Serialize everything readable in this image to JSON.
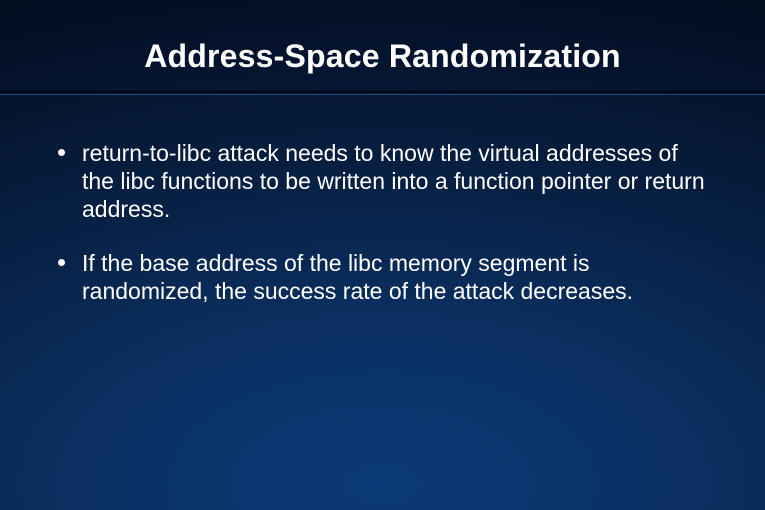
{
  "slide": {
    "title": "Address-Space Randomization",
    "bullets": [
      "return-to-libc attack needs to know the virtual addresses of the libc functions to be written into a function pointer or return address.",
      "If the base address of the libc memory segment is randomized, the success rate of the attack decreases."
    ]
  }
}
